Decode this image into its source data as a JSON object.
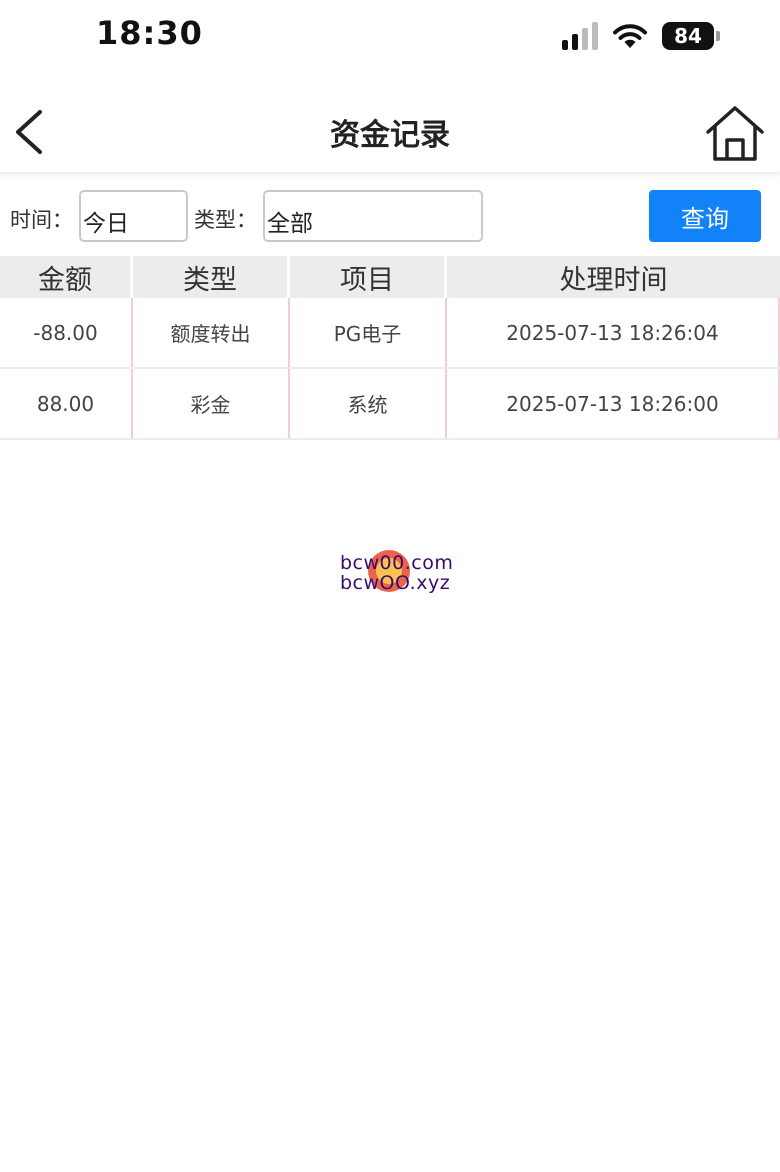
{
  "status_bar": {
    "time": "18:30",
    "battery": "84",
    "icons": [
      "signal-icon",
      "wifi-icon",
      "battery-icon"
    ]
  },
  "nav": {
    "title": "资金记录",
    "back_icon": "chevron-left-icon",
    "home_icon": "home-icon"
  },
  "filters": {
    "time_label": "时间：",
    "time_value": "今日",
    "type_label": "类型：",
    "type_value": "全部",
    "query_label": "查询",
    "accent_color": "#1182f7"
  },
  "table": {
    "headers": [
      "金额",
      "类型",
      "项目",
      "处理时间"
    ],
    "rows": [
      [
        "-88.00",
        "额度转出",
        "PG电子",
        "2025-07-13 18:26:04"
      ],
      [
        "88.00",
        "彩金",
        "系统",
        "2025-07-13 18:26:00"
      ]
    ]
  },
  "watermark": {
    "line1": "bcw00.com",
    "line2": "bcwOO.xyz"
  }
}
